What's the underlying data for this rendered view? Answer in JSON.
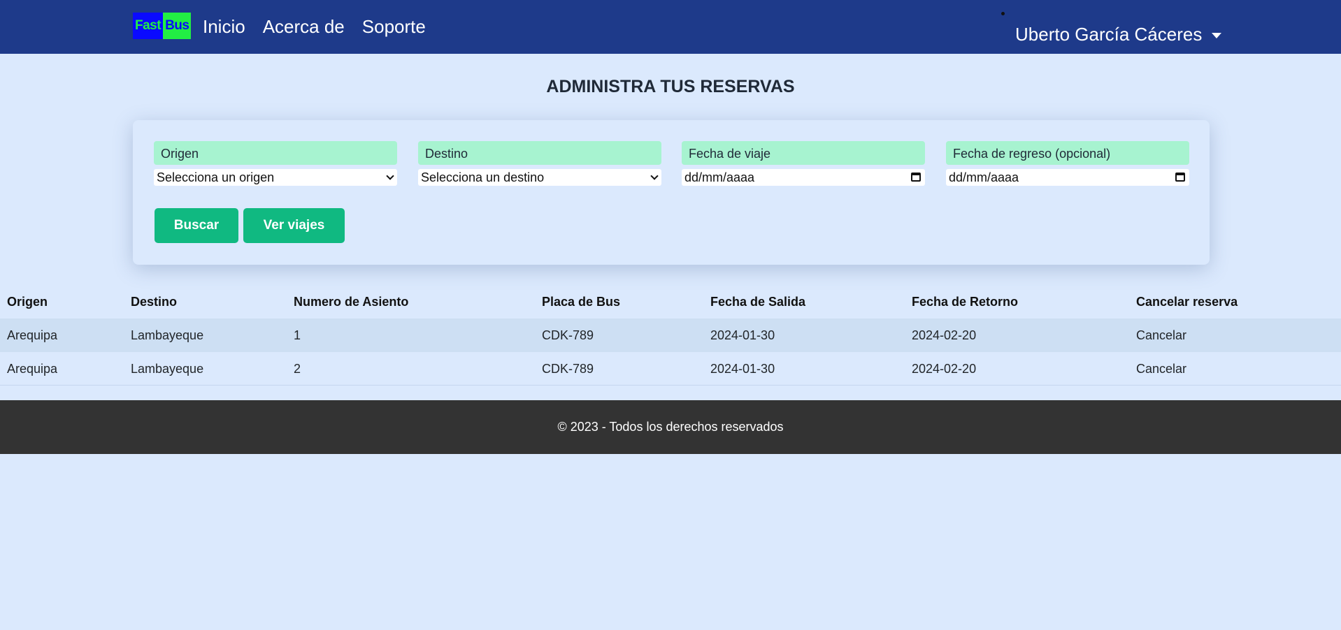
{
  "navbar": {
    "logo": {
      "part1": "Fast",
      "part2": "Bus"
    },
    "links": [
      "Inicio",
      "Acerca de",
      "Soporte"
    ],
    "user_name": "Uberto García Cáceres"
  },
  "page_title": "ADMINISTRA TUS RESERVAS",
  "search": {
    "origin_label": "Origen",
    "origin_value": "Selecciona un origen",
    "destination_label": "Destino",
    "destination_value": "Selecciona un destino",
    "travel_date_label": "Fecha de viaje",
    "travel_date_placeholder": "dd/mm/aaaa",
    "return_date_label": "Fecha de regreso (opcional)",
    "return_date_placeholder": "dd/mm/aaaa",
    "search_button": "Buscar",
    "view_trips_button": "Ver viajes"
  },
  "table": {
    "headers": [
      "Origen",
      "Destino",
      "Numero de Asiento",
      "Placa de Bus",
      "Fecha de Salida",
      "Fecha de Retorno",
      "Cancelar reserva"
    ],
    "rows": [
      [
        "Arequipa",
        "Lambayeque",
        "1",
        "CDK-789",
        "2024-01-30",
        "2024-02-20",
        "Cancelar"
      ],
      [
        "Arequipa",
        "Lambayeque",
        "2",
        "CDK-789",
        "2024-01-30",
        "2024-02-20",
        "Cancelar"
      ]
    ]
  },
  "footer": {
    "text": "© 2023 - Todos los derechos reservados"
  },
  "colors": {
    "navbar": "#1e3a8a",
    "page_background": "#dbe9fd",
    "label_background": "#a7f3d0",
    "button": "#10b981",
    "footer": "#333333"
  }
}
